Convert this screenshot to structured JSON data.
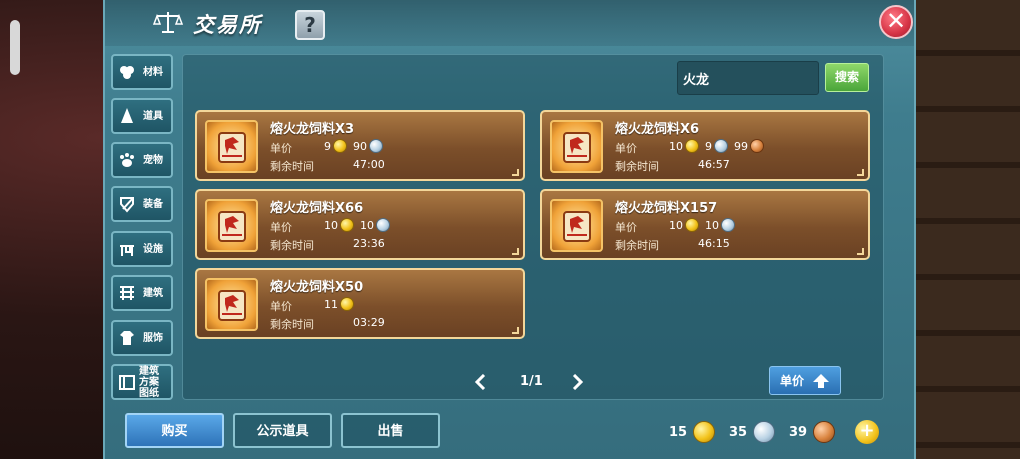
{
  "window": {
    "title": "交易所",
    "help_label": "?",
    "close_label": "✕"
  },
  "sidebar": {
    "items": [
      {
        "label": "材料",
        "icon": "material-icon"
      },
      {
        "label": "道具",
        "icon": "prop-icon"
      },
      {
        "label": "宠物",
        "icon": "paw-icon"
      },
      {
        "label": "装备",
        "icon": "equipment-icon"
      },
      {
        "label": "设施",
        "icon": "facility-icon"
      },
      {
        "label": "建筑",
        "icon": "building-icon"
      },
      {
        "label": "服饰",
        "icon": "clothing-icon"
      },
      {
        "label": "建筑方案图纸",
        "icon": "blueprint-icon"
      }
    ]
  },
  "search": {
    "value": "火龙",
    "button_label": "搜索"
  },
  "labels": {
    "price": "单价",
    "remaining_time": "剩余时间"
  },
  "listings": [
    {
      "name": "熔火龙饲料X3",
      "price": [
        {
          "amount": "9",
          "coin": "gold"
        },
        {
          "amount": "90",
          "coin": "silver"
        }
      ],
      "time": "47:00"
    },
    {
      "name": "熔火龙饲料X6",
      "price": [
        {
          "amount": "10",
          "coin": "gold"
        },
        {
          "amount": "9",
          "coin": "silver"
        },
        {
          "amount": "99",
          "coin": "copper"
        }
      ],
      "time": "46:57"
    },
    {
      "name": "熔火龙饲料X66",
      "price": [
        {
          "amount": "10",
          "coin": "gold"
        },
        {
          "amount": "10",
          "coin": "silver"
        }
      ],
      "time": "23:36"
    },
    {
      "name": "熔火龙饲料X157",
      "price": [
        {
          "amount": "10",
          "coin": "gold"
        },
        {
          "amount": "10",
          "coin": "silver"
        }
      ],
      "time": "46:15"
    },
    {
      "name": "熔火龙饲料X50",
      "price": [
        {
          "amount": "11",
          "coin": "gold"
        }
      ],
      "time": "03:29"
    }
  ],
  "pagination": {
    "page": "1/1"
  },
  "sort": {
    "label": "单价"
  },
  "tabs": {
    "buy": "购买",
    "public": "公示道具",
    "sell": "出售"
  },
  "currency": {
    "gold": "15",
    "silver": "35",
    "copper": "39"
  },
  "colors": {
    "panel": "#3f7d8e",
    "card": "#8b5a2f",
    "card_border": "#f3d79a",
    "search_button": "#4aa53a",
    "active_tab": "#2e73b8"
  }
}
